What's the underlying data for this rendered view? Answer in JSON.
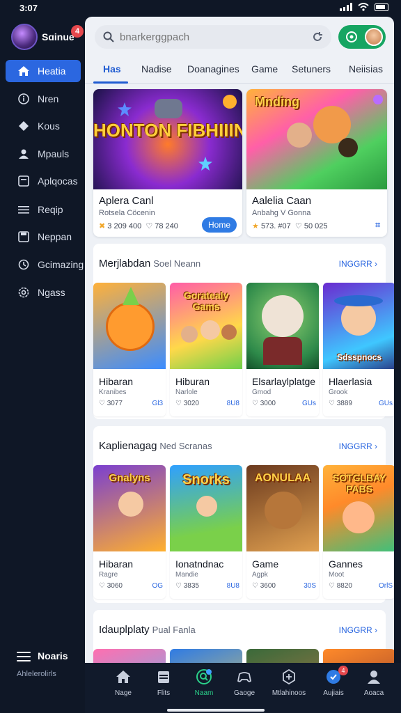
{
  "status": {
    "time": "3:07"
  },
  "profile": {
    "name": "Sɑinue",
    "badge": "4"
  },
  "sidebar": {
    "items": [
      {
        "label": "Heatia",
        "icon": "home-icon",
        "active": true
      },
      {
        "label": "Nren",
        "icon": "info-icon"
      },
      {
        "label": "Kous",
        "icon": "diamond-icon"
      },
      {
        "label": "Mpauls",
        "icon": "person-icon"
      },
      {
        "label": "Aplqocas",
        "icon": "document-icon"
      },
      {
        "label": "Reqip",
        "icon": "list-icon"
      },
      {
        "label": "Neppan",
        "icon": "save-icon"
      },
      {
        "label": "Gcimazing",
        "icon": "history-icon"
      },
      {
        "label": "Ngass",
        "icon": "settings-icon"
      }
    ],
    "footer": {
      "title": "Noaris",
      "subtitle": "Ahlelerolirls"
    }
  },
  "search": {
    "placeholder": "bnarkerggpach"
  },
  "tabs": [
    "Has",
    "Nadise",
    "Doanagines",
    "Game",
    "Setuners",
    "Neiisias"
  ],
  "featured": [
    {
      "art_text": "HONTON FIBHIIIN",
      "title": "Aplera Canl",
      "subtitle": "Rotsela Cöcenin",
      "stats": "3 209 400",
      "stats2": "78 240",
      "button": "Home",
      "colors": [
        "#2a1d6b",
        "#ff8a2a"
      ]
    },
    {
      "art_text": "Mnding",
      "title": "Aalelia Caan",
      "subtitle": "Anbahg V Gonna",
      "stats": "573. #07",
      "stats2": "50 025",
      "icon": "gamepad-icon",
      "colors": [
        "#3fbf5a",
        "#ffcf3a"
      ]
    }
  ],
  "sections": [
    {
      "title": "Merjlabdan",
      "subtitle": "Soel Neann",
      "more": "INGGRR",
      "cards": [
        {
          "name": "Hibaran",
          "category": "Kranibes",
          "plays": "3077",
          "rating": "Gl3",
          "art_text": "",
          "colors": [
            "#ff9b2f",
            "#3b8cff"
          ]
        },
        {
          "name": "Hiburan",
          "category": "Narlole",
          "plays": "3020",
          "rating": "8U8",
          "art_text": "Goratealy Gams",
          "colors": [
            "#ff5ca8",
            "#ffd84a"
          ]
        },
        {
          "name": "Elsarlaylplatge",
          "category": "Gmod",
          "plays": "3000",
          "rating": "GUs",
          "art_text": "",
          "colors": [
            "#2e8a4a",
            "#8fd070"
          ]
        },
        {
          "name": "Hlaerlasia",
          "category": "Grook",
          "plays": "3889",
          "rating": "GUs",
          "art_text": "Sdsspnocs",
          "colors": [
            "#6a2bd0",
            "#3fc7ff"
          ]
        }
      ]
    },
    {
      "title": "Kaplienagag",
      "subtitle": "Ned Scranas",
      "more": "INGGRR",
      "cards": [
        {
          "name": "Hibaran",
          "category": "Ragre",
          "plays": "3060",
          "rating": "OG",
          "art_text": "Gnalyns",
          "colors": [
            "#7a3fd0",
            "#ffb02e"
          ]
        },
        {
          "name": "Ionatndnac",
          "category": "Mandie",
          "plays": "3835",
          "rating": "8U8",
          "art_text": "Snorks",
          "colors": [
            "#2fa0ff",
            "#7ad04a"
          ]
        },
        {
          "name": "Game",
          "category": "Agpk",
          "plays": "3600",
          "rating": "30S",
          "art_text": "AONULAA",
          "colors": [
            "#6b3a1e",
            "#e0a050"
          ]
        },
        {
          "name": "Gannes",
          "category": "Moot",
          "plays": "8820",
          "rating": "OrlS",
          "art_text": "SOTGLBAY PABS",
          "colors": [
            "#ff8a2a",
            "#3fc07a"
          ]
        }
      ]
    },
    {
      "title": "Idauplplaty",
      "subtitle": "Pual Fanla",
      "more": "INGGRR"
    }
  ],
  "bottom_nav": [
    {
      "label": "Nage",
      "icon": "home-icon"
    },
    {
      "label": "Flits",
      "icon": "calendar-icon"
    },
    {
      "label": "Naam",
      "icon": "search-icon",
      "active": true
    },
    {
      "label": "Gaoge",
      "icon": "gamepad-icon"
    },
    {
      "label": "Mtlahinoos",
      "icon": "add-icon"
    },
    {
      "label": "Aujiais",
      "icon": "globe-icon",
      "badge": "4"
    },
    {
      "label": "Aoaca",
      "icon": "user-icon"
    }
  ]
}
